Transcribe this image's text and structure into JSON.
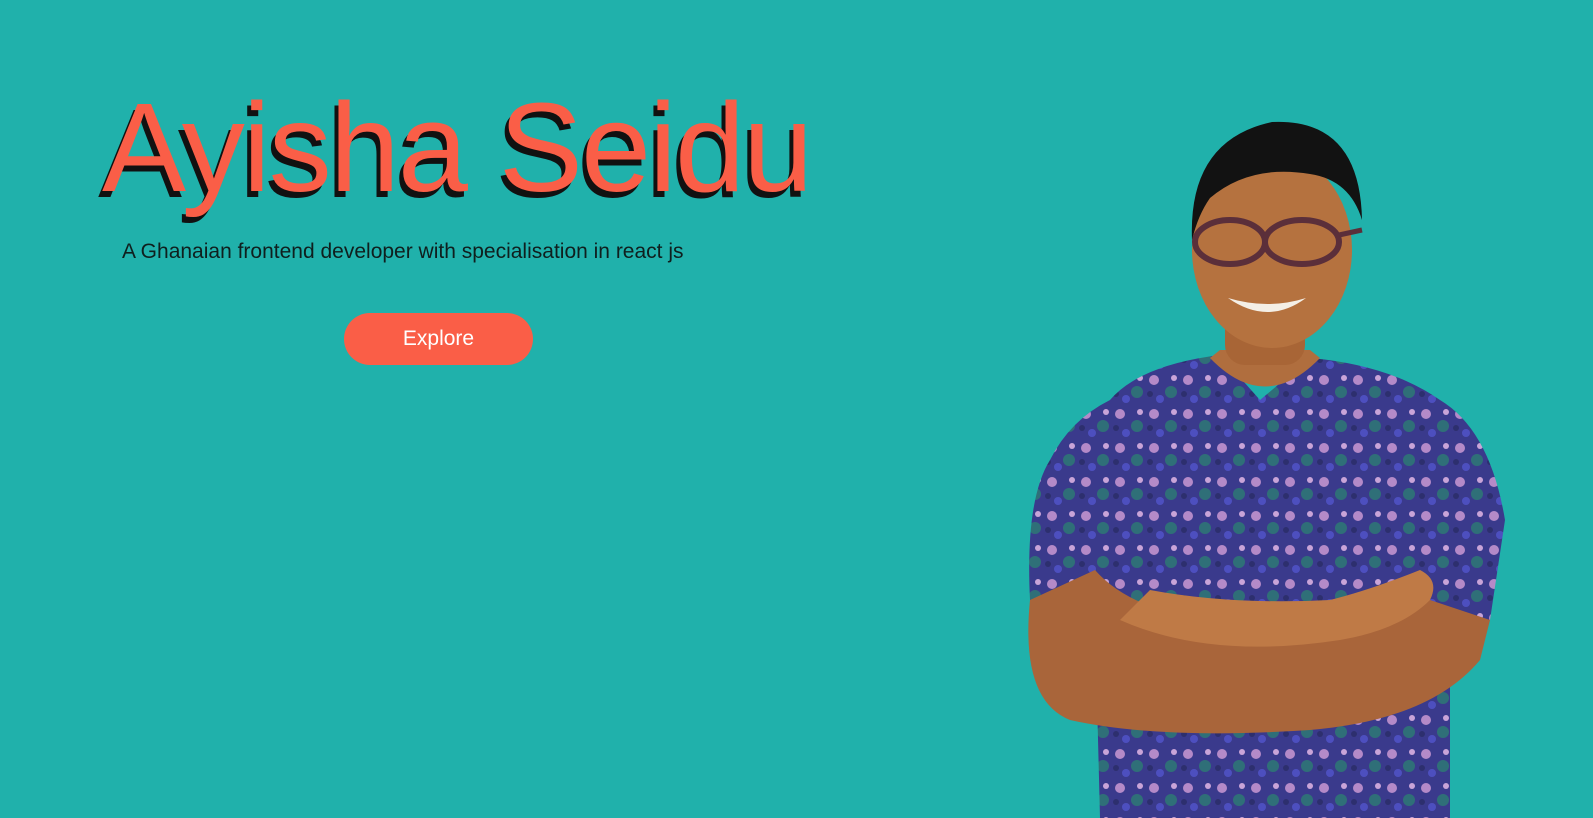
{
  "hero": {
    "title": "Ayisha Seidu",
    "subtitle": "A Ghanaian frontend developer with specialisation in react js",
    "cta_label": "Explore"
  },
  "colors": {
    "background": "#20b1ab",
    "accent": "#fa5e47",
    "title_shadow": "#111111",
    "button_text": "#ffffff"
  },
  "portrait": {
    "icon": "person-portrait-icon"
  }
}
